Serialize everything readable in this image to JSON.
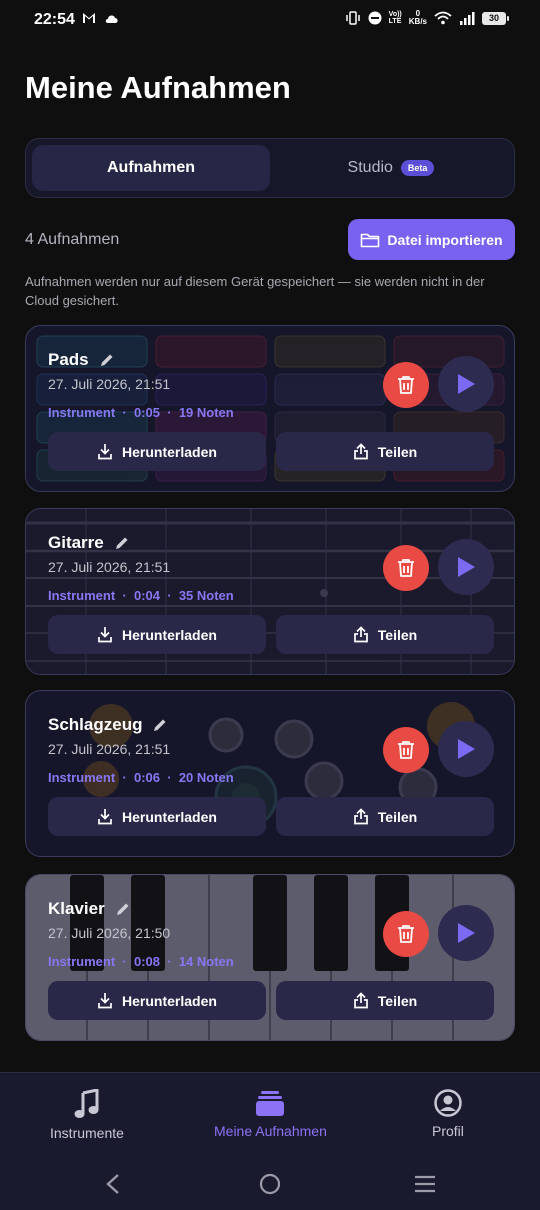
{
  "status": {
    "time": "22:54",
    "kb": "0",
    "kb_unit": "KB/s",
    "net": "LTE",
    "net_top": "Vo))",
    "battery": "30"
  },
  "header": {
    "title": "Meine Aufnahmen"
  },
  "tabs": [
    {
      "label": "Aufnahmen",
      "active": true
    },
    {
      "label": "Studio",
      "badge": "Beta",
      "active": false
    }
  ],
  "summary": {
    "count": "4 Aufnahmen",
    "import_label": "Datei importieren"
  },
  "note": "Aufnahmen werden nur auf diesem Gerät gespeichert — sie werden nicht in der Cloud gesichert.",
  "recordings": [
    {
      "title": "Pads",
      "date": "27. Juli 2026, 21:51",
      "instrument": "Instrument",
      "duration": "0:05",
      "notes": "19 Noten",
      "download": "Herunterladen",
      "share": "Teilen",
      "bg": "pads"
    },
    {
      "title": "Gitarre",
      "date": "27. Juli 2026, 21:51",
      "instrument": "Instrument",
      "duration": "0:04",
      "notes": "35 Noten",
      "download": "Herunterladen",
      "share": "Teilen",
      "bg": "guitar"
    },
    {
      "title": "Schlagzeug",
      "date": "27. Juli 2026, 21:51",
      "instrument": "Instrument",
      "duration": "0:06",
      "notes": "20 Noten",
      "download": "Herunterladen",
      "share": "Teilen",
      "bg": "drums"
    },
    {
      "title": "Klavier",
      "date": "27. Juli 2026, 21:50",
      "instrument": "Instrument",
      "duration": "0:08",
      "notes": "14 Noten",
      "download": "Herunterladen",
      "share": "Teilen",
      "bg": "piano"
    }
  ],
  "meta_separator": "·",
  "nav": [
    {
      "label": "Instrumente",
      "icon": "music-note-icon",
      "active": false
    },
    {
      "label": "Meine Aufnahmen",
      "icon": "folder-stack-icon",
      "active": true
    },
    {
      "label": "Profil",
      "icon": "profile-icon",
      "active": false
    }
  ],
  "colors": {
    "accent": "#7a62f0",
    "delete": "#ea4a44",
    "background": "#0f0f10"
  }
}
